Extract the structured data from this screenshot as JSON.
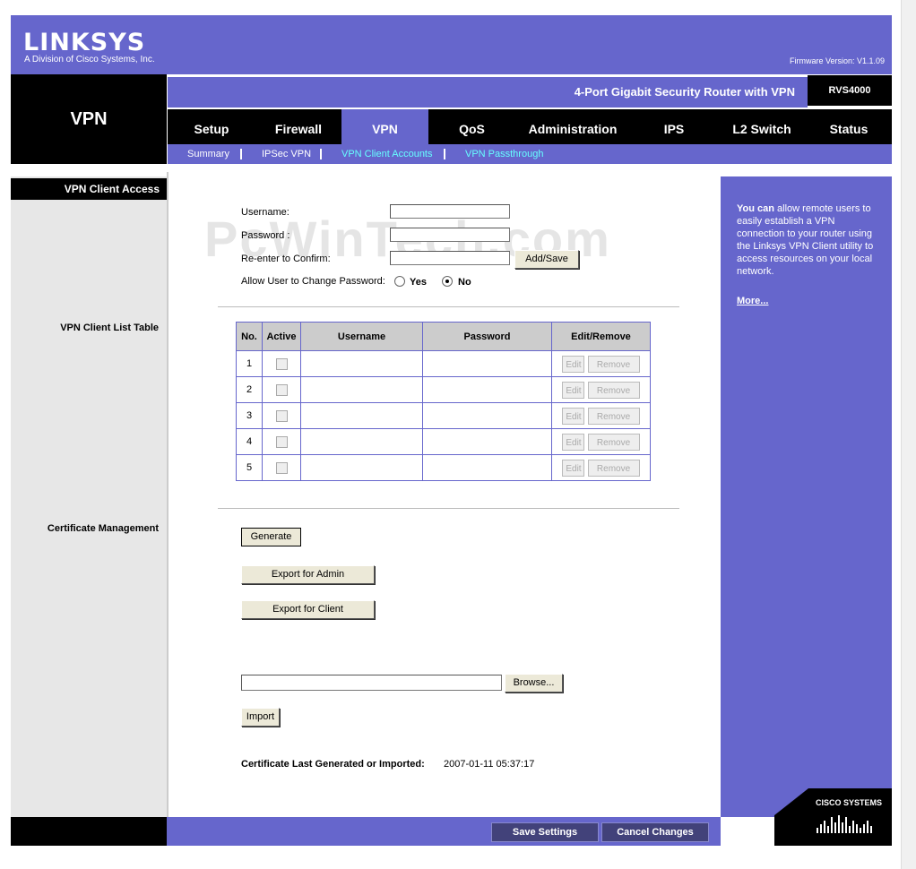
{
  "header": {
    "brand": "LINKSYS",
    "brand_sub": "A Division of Cisco Systems, Inc.",
    "firmware": "Firmware Version: V1.1.09",
    "product_name": "4-Port Gigabit Security Router with VPN",
    "model": "RVS4000",
    "section_title": "VPN"
  },
  "tabs": [
    {
      "label": "Setup"
    },
    {
      "label": "Firewall"
    },
    {
      "label": "VPN"
    },
    {
      "label": "QoS"
    },
    {
      "label": "Administration"
    },
    {
      "label": "IPS"
    },
    {
      "label": "L2 Switch"
    },
    {
      "label": "Status"
    }
  ],
  "subtabs": [
    {
      "label": "Summary"
    },
    {
      "label": "IPSec VPN"
    },
    {
      "label": "VPN Client Accounts"
    },
    {
      "label": "VPN Passthrough"
    }
  ],
  "left": {
    "section": "VPN Client Access",
    "list_table": "VPN Client List Table",
    "cert_mgmt": "Certificate Management"
  },
  "form": {
    "username_label": "Username:",
    "password_label": "Password :",
    "confirm_label": "Re-enter to Confirm:",
    "add_save": "Add/Save",
    "allow_change_label": "Allow User to Change Password:",
    "yes": "Yes",
    "no": "No",
    "selected": "No"
  },
  "table": {
    "headers": [
      "No.",
      "Active",
      "Username",
      "Password",
      "Edit/Remove"
    ],
    "rows": [
      {
        "no": "1",
        "username": "",
        "password": ""
      },
      {
        "no": "2",
        "username": "",
        "password": ""
      },
      {
        "no": "3",
        "username": "",
        "password": ""
      },
      {
        "no": "4",
        "username": "",
        "password": ""
      },
      {
        "no": "5",
        "username": "",
        "password": ""
      }
    ],
    "edit": "Edit",
    "remove": "Remove"
  },
  "cert": {
    "generate": "Generate",
    "export_admin": "Export for Admin",
    "export_client": "Export for Client",
    "browse": "Browse...",
    "import": "Import",
    "last_label": "Certificate Last Generated or Imported:",
    "last_value": "2007-01-11 05:37:17"
  },
  "help": {
    "bold": "You can",
    "text": " allow remote users to easily establish a VPN connection to your router using the Linksys VPN Client utility to access resources on your local network.",
    "more": "More..."
  },
  "footer": {
    "save": "Save Settings",
    "cancel": "Cancel Changes"
  },
  "cisco_logo": "CISCO SYSTEMS",
  "watermark": "PcWinTech.com",
  "colors": {
    "accent": "#6666cc",
    "active_subtab": "#66ffff",
    "dark": "#000000"
  }
}
